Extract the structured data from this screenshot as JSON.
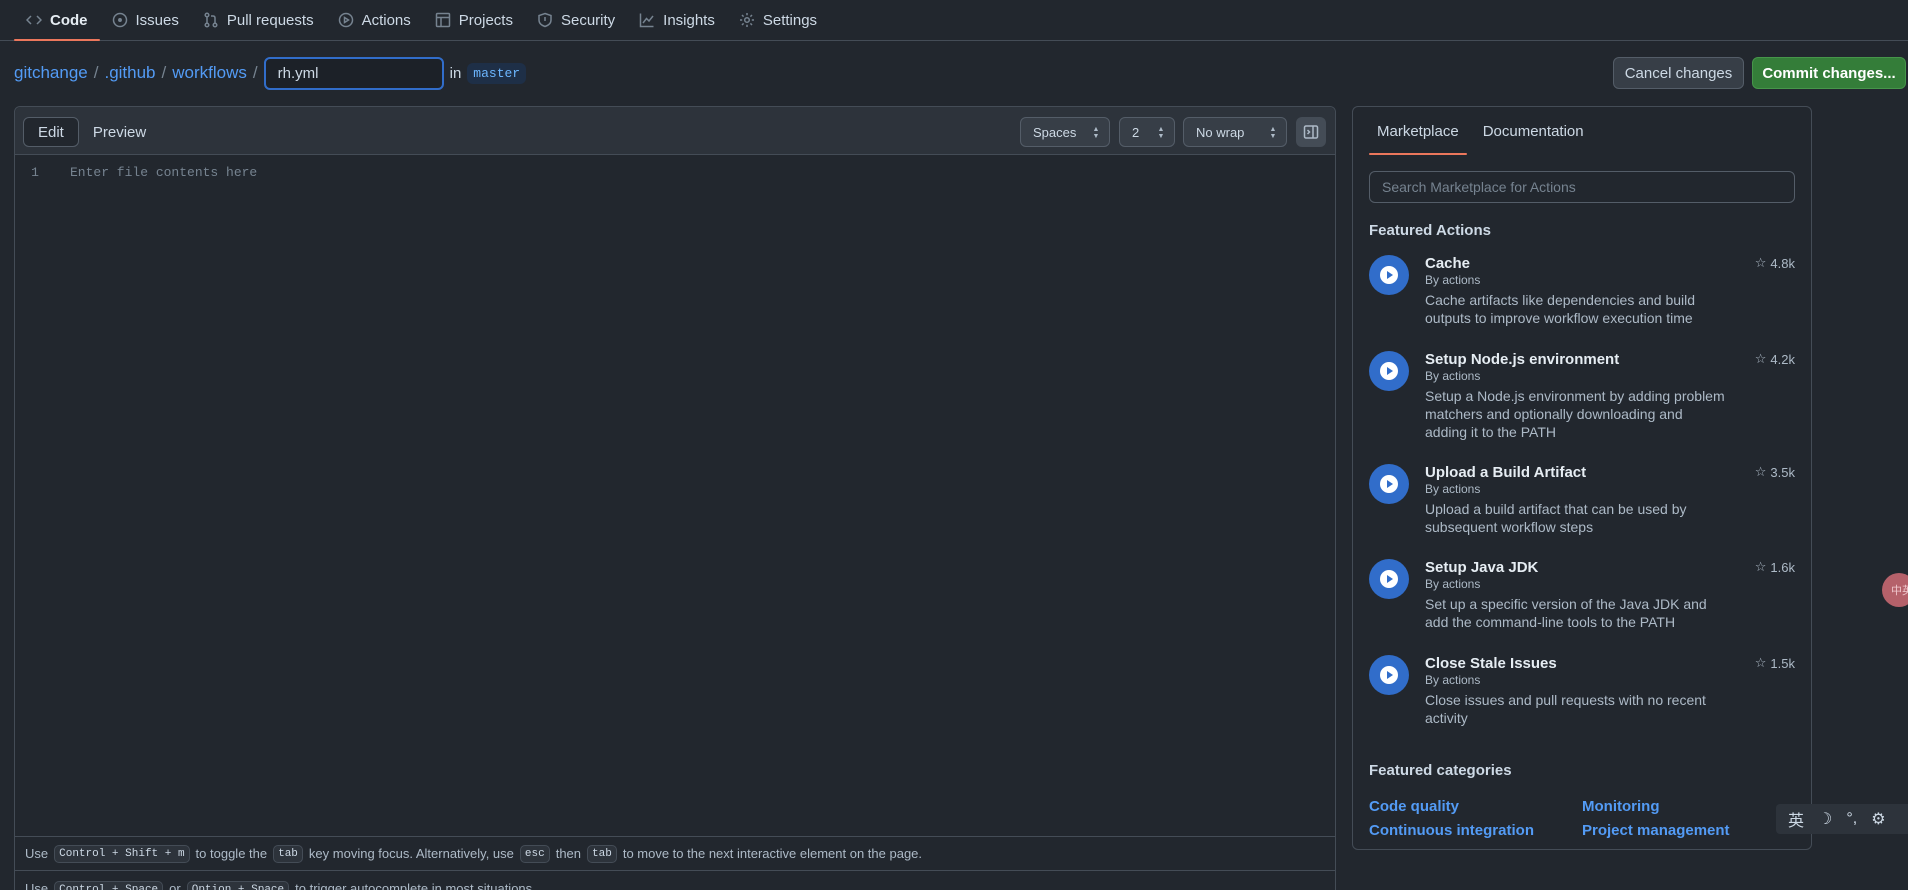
{
  "nav": {
    "items": [
      {
        "label": "Code",
        "icon": "code-icon"
      },
      {
        "label": "Issues",
        "icon": "issue-icon"
      },
      {
        "label": "Pull requests",
        "icon": "pull-request-icon"
      },
      {
        "label": "Actions",
        "icon": "play-icon"
      },
      {
        "label": "Projects",
        "icon": "table-icon"
      },
      {
        "label": "Security",
        "icon": "shield-icon"
      },
      {
        "label": "Insights",
        "icon": "graph-icon"
      },
      {
        "label": "Settings",
        "icon": "gear-icon"
      }
    ]
  },
  "breadcrumb": {
    "repo": "gitchange",
    "sep": "/",
    "folder1": ".github",
    "folder2": "workflows",
    "filename": "rh.yml",
    "in": "in",
    "branch": "master"
  },
  "buttons": {
    "cancel": "Cancel changes",
    "commit": "Commit changes..."
  },
  "editor": {
    "tabs": {
      "edit": "Edit",
      "preview": "Preview"
    },
    "indent_mode": "Spaces",
    "indent_size": "2",
    "wrap_mode": "No wrap",
    "line_number": "1",
    "placeholder": "Enter file contents here"
  },
  "hints": {
    "line1": {
      "use": "Use",
      "keys1": "Control + Shift + m",
      "t1": "to toggle the",
      "key_tab": "tab",
      "t2": "key moving focus. Alternatively, use",
      "key_esc": "esc",
      "t3": "then",
      "key_tab2": "tab",
      "t4": "to move to the next interactive element on the page."
    },
    "line2": {
      "use": "Use",
      "keys1": "Control + Space",
      "or": "or",
      "keys2": "Option + Space",
      "t1": "to trigger autocomplete in most situations."
    }
  },
  "sidepanel": {
    "tabs": {
      "marketplace": "Marketplace",
      "documentation": "Documentation"
    },
    "search_placeholder": "Search Marketplace for Actions",
    "featured_actions_title": "Featured Actions",
    "actions": [
      {
        "name": "Cache",
        "by": "By actions",
        "desc": "Cache artifacts like dependencies and build outputs to improve workflow execution time",
        "stars": "4.8k"
      },
      {
        "name": "Setup Node.js environment",
        "by": "By actions",
        "desc": "Setup a Node.js environment by adding problem matchers and optionally downloading and adding it to the PATH",
        "stars": "4.2k"
      },
      {
        "name": "Upload a Build Artifact",
        "by": "By actions",
        "desc": "Upload a build artifact that can be used by subsequent workflow steps",
        "stars": "3.5k"
      },
      {
        "name": "Setup Java JDK",
        "by": "By actions",
        "desc": "Set up a specific version of the Java JDK and add the command-line tools to the PATH",
        "stars": "1.6k"
      },
      {
        "name": "Close Stale Issues",
        "by": "By actions",
        "desc": "Close issues and pull requests with no recent activity",
        "stars": "1.5k"
      }
    ],
    "featured_categories_title": "Featured categories",
    "categories": [
      "Code quality",
      "Monitoring",
      "Continuous integration",
      "Project management"
    ]
  },
  "ime": {
    "badge": "中英",
    "lang": "英",
    "moon": "☽",
    "punct": "°,",
    "gear": "⚙"
  },
  "colors": {
    "background": "#22272e",
    "link": "#539bf5",
    "commit": "#347d39",
    "accent_underline": "#ec775c",
    "action_icon": "#316dca"
  }
}
